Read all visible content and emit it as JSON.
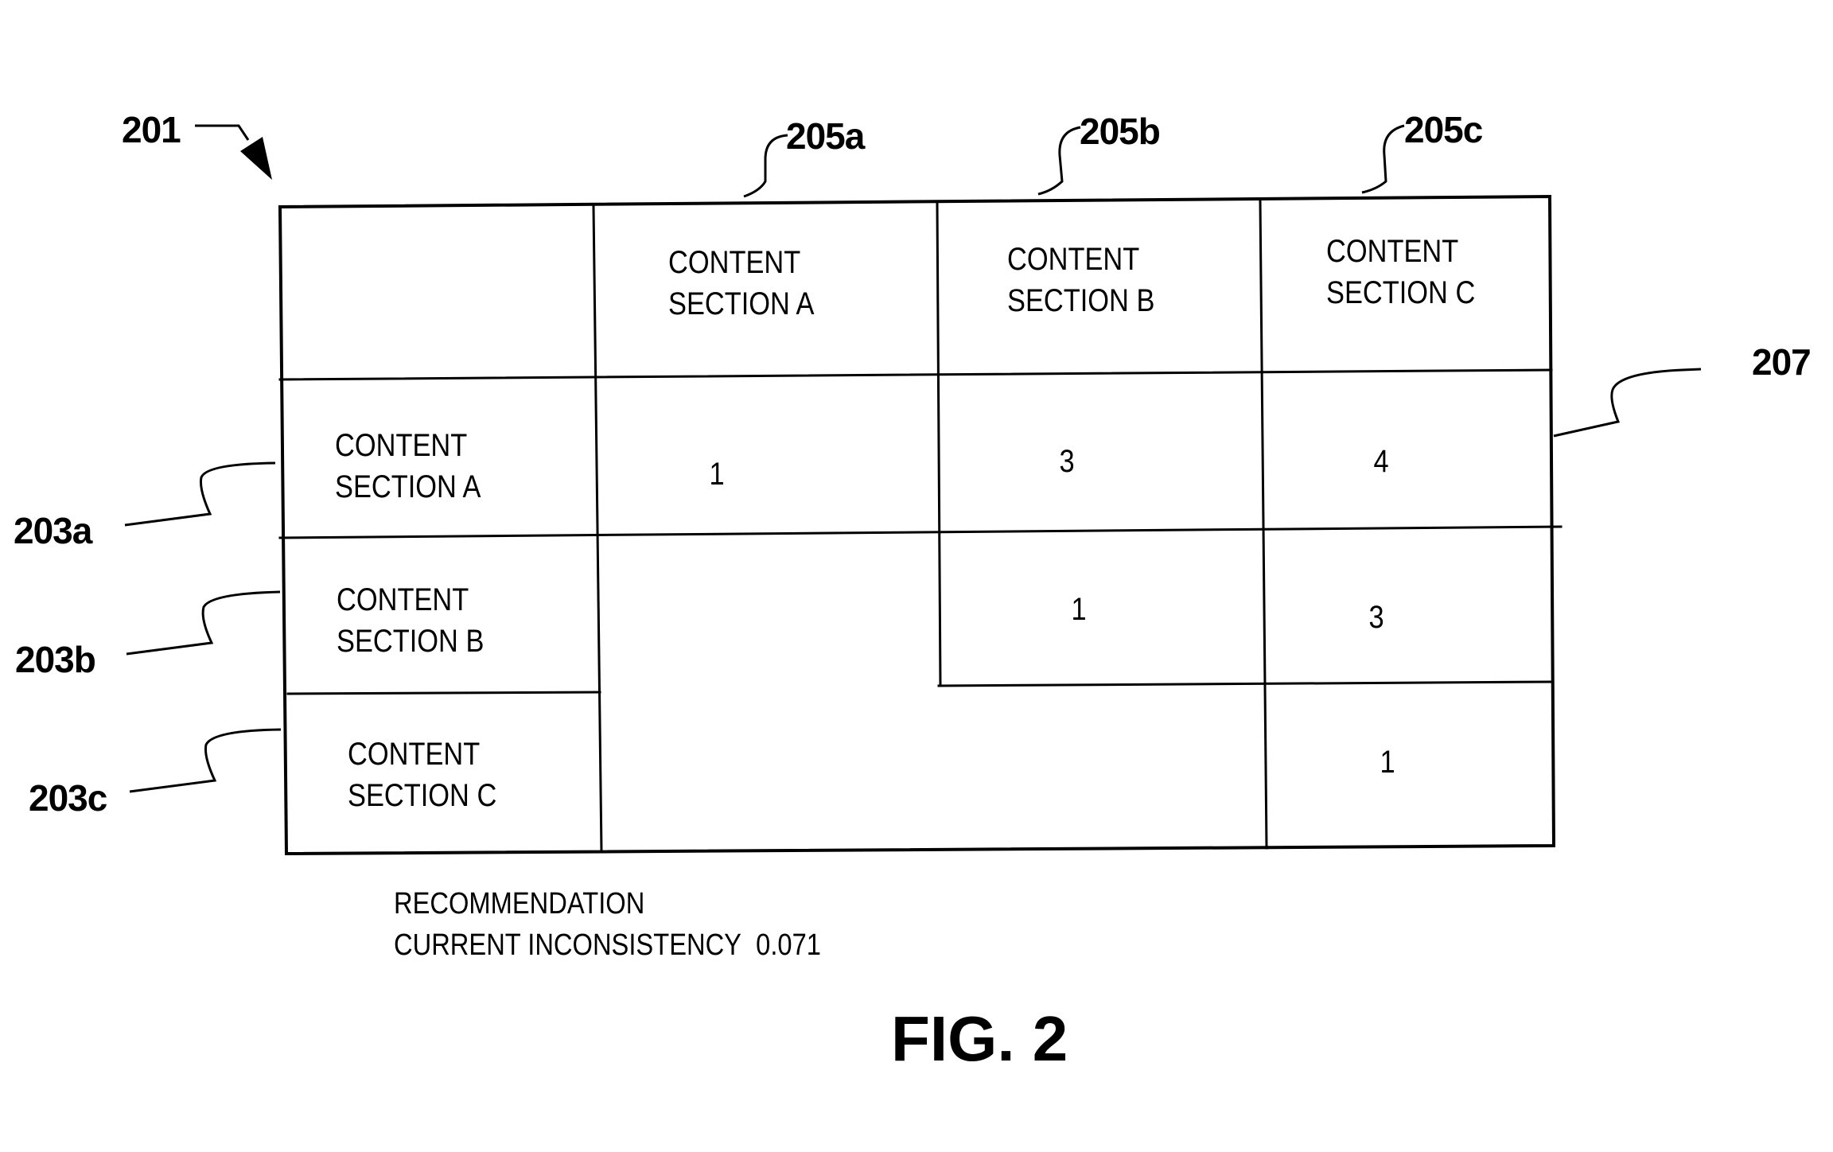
{
  "figure": {
    "caption": "FIG. 2",
    "reference_numerals": {
      "matrix": "201",
      "row_labels": [
        "203a",
        "203b",
        "203c"
      ],
      "column_labels": [
        "205a",
        "205b",
        "205c"
      ],
      "values_region": "207"
    }
  },
  "matrix": {
    "column_headers": [
      {
        "line1": "CONTENT",
        "line2": "SECTION A"
      },
      {
        "line1": "CONTENT",
        "line2": "SECTION B"
      },
      {
        "line1": "CONTENT",
        "line2": "SECTION C"
      }
    ],
    "row_headers": [
      {
        "line1": "CONTENT",
        "line2": "SECTION A"
      },
      {
        "line1": "CONTENT",
        "line2": "SECTION B"
      },
      {
        "line1": "CONTENT",
        "line2": "SECTION C"
      }
    ],
    "rows": [
      [
        "1",
        "3",
        "4"
      ],
      [
        "",
        "1",
        "3"
      ],
      [
        "",
        "",
        "1"
      ]
    ]
  },
  "footer": {
    "line1": "RECOMMENDATION",
    "line2_label": "CURRENT INCONSISTENCY",
    "line2_value": "0.071"
  }
}
